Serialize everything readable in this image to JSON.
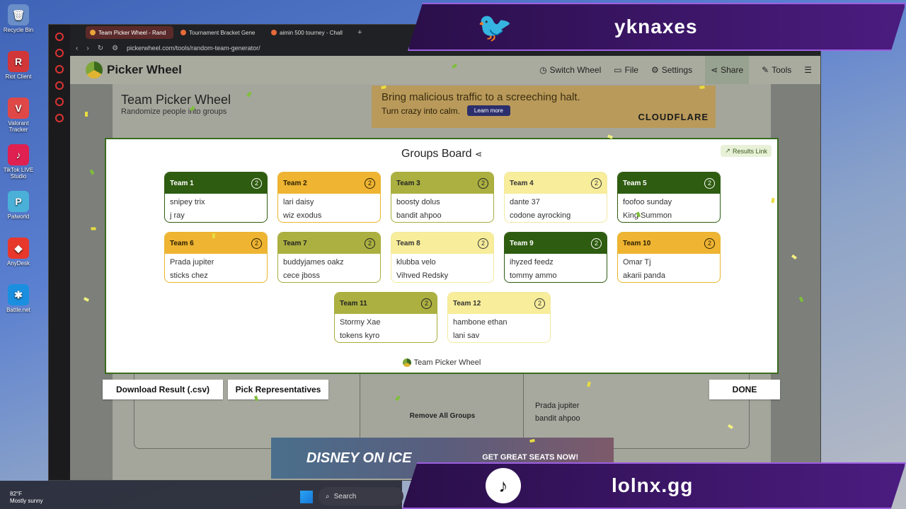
{
  "desktop_icons": [
    {
      "label": "Recycle Bin",
      "color": "#6a8fc8",
      "glyph": "🗑"
    },
    {
      "label": "Riot Client",
      "color": "#d13639",
      "glyph": "R"
    },
    {
      "label": "Valorant Tracker",
      "color": "#e04848",
      "glyph": "V"
    },
    {
      "label": "TikTok LIVE Studio",
      "color": "#e02050",
      "glyph": "♪"
    },
    {
      "label": "Palworld",
      "color": "#4ab0d8",
      "glyph": "P"
    },
    {
      "label": "AnyDesk",
      "color": "#e8382c",
      "glyph": "◆"
    },
    {
      "label": "Battle.net",
      "color": "#1a8fe0",
      "glyph": "✱"
    }
  ],
  "browser": {
    "tabs": [
      {
        "label": "Team Picker Wheel - Rand",
        "active": true
      },
      {
        "label": "Tournament Bracket Gene",
        "active": false
      },
      {
        "label": "aimin 500 tourney - Chall",
        "active": false
      }
    ],
    "url": "pickerwheel.com/tools/random-team-generator/"
  },
  "site": {
    "logo": "Picker Wheel",
    "nav": [
      "Switch Wheel",
      "File",
      "Settings",
      "Share",
      "Tools"
    ],
    "page_title": "Team Picker Wheel",
    "page_subtitle": "Randomize people into groups"
  },
  "ads": {
    "top_line1": "Bring malicious traffic to a screeching halt.",
    "top_line2": "Turn crazy into calm.",
    "top_button": "Learn more",
    "top_brand": "CLOUDFLARE",
    "bottom_brand": "DISNEY ON ICE",
    "bottom_cta": "GET GREAT SEATS NOW!"
  },
  "modal": {
    "title": "Groups Board",
    "results_link": "Results Link",
    "footer": "Team Picker Wheel",
    "teams": [
      {
        "name": "Team 1",
        "count": "2",
        "members": [
          "snipey trix",
          "j ray"
        ],
        "style": "dark"
      },
      {
        "name": "Team 2",
        "count": "2",
        "members": [
          "lari daisy",
          "wiz exodus"
        ],
        "style": "gold"
      },
      {
        "name": "Team 3",
        "count": "2",
        "members": [
          "boosty dolus",
          "bandit ahpoo"
        ],
        "style": "olive"
      },
      {
        "name": "Team 4",
        "count": "2",
        "members": [
          "dante 37",
          "codone ayrocking"
        ],
        "style": "pale"
      },
      {
        "name": "Team 5",
        "count": "2",
        "members": [
          "foofoo sunday",
          "King Summon"
        ],
        "style": "dark"
      },
      {
        "name": "Team 6",
        "count": "2",
        "members": [
          "Prada jupiter",
          "sticks chez"
        ],
        "style": "gold"
      },
      {
        "name": "Team 7",
        "count": "2",
        "members": [
          "buddyjames oakz",
          "cece jboss"
        ],
        "style": "olive"
      },
      {
        "name": "Team 8",
        "count": "2",
        "members": [
          "klubba velo",
          "Vihved Redsky"
        ],
        "style": "pale"
      },
      {
        "name": "Team 9",
        "count": "2",
        "members": [
          "ihyzed feedz",
          "tommy ammo"
        ],
        "style": "dark"
      },
      {
        "name": "Team 10",
        "count": "2",
        "members": [
          "Omar Tj",
          "akarii panda"
        ],
        "style": "gold"
      },
      {
        "name": "Team 11",
        "count": "2",
        "members": [
          "Stormy Xae",
          "tokens kyro"
        ],
        "style": "olive"
      },
      {
        "name": "Team 12",
        "count": "2",
        "members": [
          "hambone ethan",
          "lani sav"
        ],
        "style": "pale"
      }
    ]
  },
  "background_panel": {
    "remove_all": "Remove All Groups",
    "list_items": [
      "Prada jupiter",
      "bandit ahpoo"
    ]
  },
  "actions": {
    "download": "Download Result (.csv)",
    "pick_reps": "Pick Representatives",
    "done": "DONE"
  },
  "overlay": {
    "twitter_handle": "yknaxes",
    "tiktok_handle": "lolnx.gg"
  },
  "taskbar": {
    "weather_temp": "82°F",
    "weather_desc": "Mostly sunny",
    "search": "Search"
  }
}
